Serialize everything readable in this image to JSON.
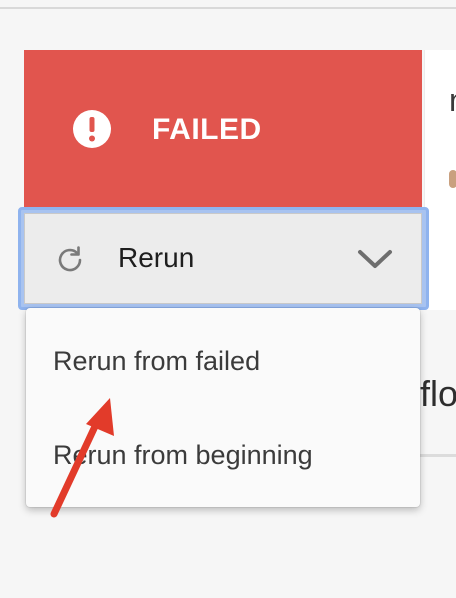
{
  "status": {
    "label": "FAILED",
    "banner_color": "#e1554e",
    "icon": "alert-circle-icon"
  },
  "rerun": {
    "label": "Rerun",
    "icon": "refresh-icon",
    "dropdown_icon": "chevron-down-icon",
    "focus_color": "#8fb3ee"
  },
  "menu": {
    "items": [
      {
        "label": "Rerun from failed"
      },
      {
        "label": "Rerun from beginning"
      }
    ]
  },
  "background_partial": {
    "glyph_top": "n",
    "glyph_middle": "flo"
  },
  "annotation": {
    "arrow_color": "#e23b2a"
  }
}
